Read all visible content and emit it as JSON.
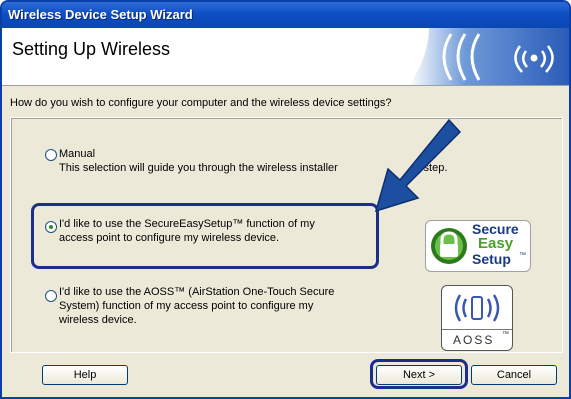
{
  "window": {
    "title": "Wireless Device Setup Wizard"
  },
  "header": {
    "title": "Setting Up Wireless",
    "banner_icon": "wireless-signal-icon"
  },
  "question": "How do you wish to configure your computer and the wireless device settings?",
  "options": [
    {
      "label": "Manual",
      "description": "This selection will guide you through the wireless installer",
      "description_suffix": "y step.",
      "selected": false
    },
    {
      "label_line1": "I'd like to use the SecureEasySetup™ function of my",
      "label_line2": "access point to configure my wireless device.",
      "selected": true
    },
    {
      "label_line1": "I'd like to use the AOSS™ (AirStation One-Touch Secure",
      "label_line2": "System) function of my access point to configure my",
      "label_line3": "wireless device.",
      "selected": false
    }
  ],
  "logos": {
    "ses": {
      "word1": "Secure",
      "word2": "Easy",
      "word3": "Setup",
      "tm": "™"
    },
    "aoss": {
      "text": "AOSS",
      "tm": "™"
    }
  },
  "buttons": {
    "help": "Help",
    "next": "Next >",
    "cancel": "Cancel"
  },
  "colors": {
    "titlebar": "#0e4fc4",
    "dialog_bg": "#ece9d8",
    "highlight_ring": "#1b2f8a",
    "arrow": "#1d4fa0",
    "ses_green": "#4aa02c"
  }
}
